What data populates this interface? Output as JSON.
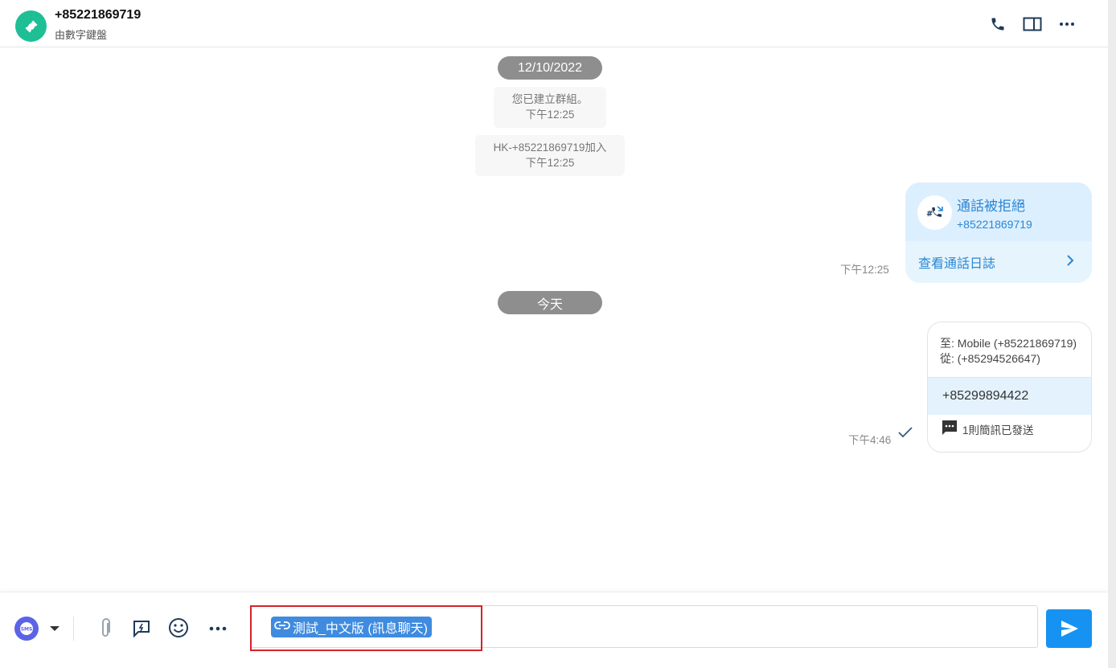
{
  "header": {
    "contact_name": "+85221869719",
    "contact_subtitle": "由數字鍵盤",
    "avatar_icon": "ticket-icon",
    "actions": [
      "phone-icon",
      "split-view-icon",
      "more-horizontal-icon"
    ]
  },
  "messages": {
    "date_pill_1": "12/10/2022",
    "system_1": {
      "text": "您已建立群組。",
      "time": "下午12:25"
    },
    "system_2": {
      "text": "HK-+85221869719加入",
      "time": "下午12:25"
    },
    "call_card": {
      "title": "通話被拒絕",
      "number": "+85221869719",
      "link_label": "查看通話日誌",
      "time": "下午12:25",
      "icon": "rejected-call-icon"
    },
    "date_pill_2": "今天",
    "fax_card": {
      "to_line": "至: Mobile (+85221869719)",
      "from_line": "從: (+85294526647)",
      "number": "+85299894422",
      "status": "1則簡訊已發送",
      "time": "下午4:46",
      "status_icon": "check-icon"
    }
  },
  "composer": {
    "chip_label": "測試_中文版 (訊息聊天)",
    "tools": [
      "sms-icon",
      "dropdown-icon",
      "paperclip-icon",
      "quick-reply-icon",
      "emoji-icon",
      "more-horizontal-icon"
    ],
    "send_icon": "send-icon"
  },
  "colors": {
    "accent_blue": "#1693f2",
    "avatar_green": "#1fbf95",
    "link_blue": "#2b87d1",
    "highlight_red": "#d3232c"
  }
}
